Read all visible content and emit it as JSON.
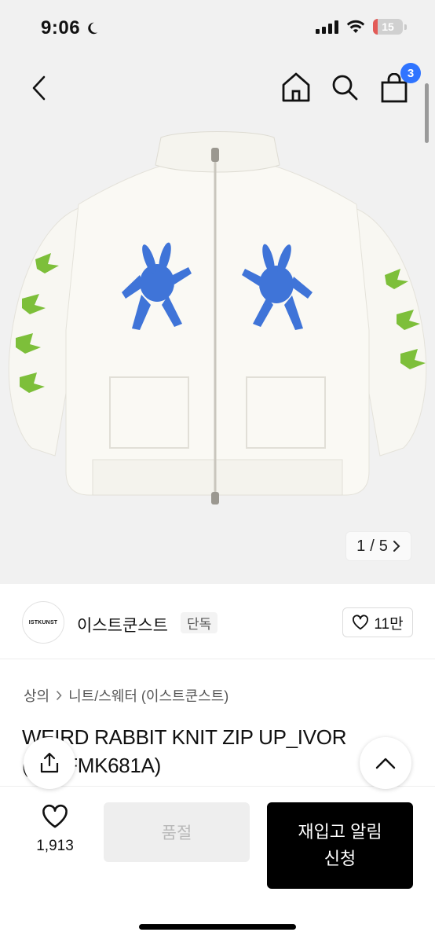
{
  "status_bar": {
    "time": "9:06",
    "battery_level": "15",
    "battery_percent": 15,
    "wifi_icon": "wifi-icon",
    "signal_icon": "cellular-signal-icon",
    "focus_icon": "moon-icon"
  },
  "header": {
    "back_icon": "chevron-left-icon",
    "home_icon": "home-icon",
    "search_icon": "search-icon",
    "cart_icon": "shopping-bag-icon",
    "cart_count": "3",
    "badge_color": "#2f74ff"
  },
  "gallery": {
    "current": "1",
    "separator": "/",
    "total": "5"
  },
  "brand": {
    "logo_text": "ISTKUNST",
    "name": "이스트쿤스트",
    "tag": "단독",
    "likes": "11만"
  },
  "breadcrumb": {
    "level1": "상의",
    "level2": "니트/스웨터 (이스트쿤스트)"
  },
  "product": {
    "title": "WEIRD RABBIT KNIT ZIP UP_IVOR\n(22DFMK681A)"
  },
  "actions": {
    "wish_count": "1,913",
    "soldout_label": "품절",
    "restock_label": "재입고 알림\n신청"
  }
}
